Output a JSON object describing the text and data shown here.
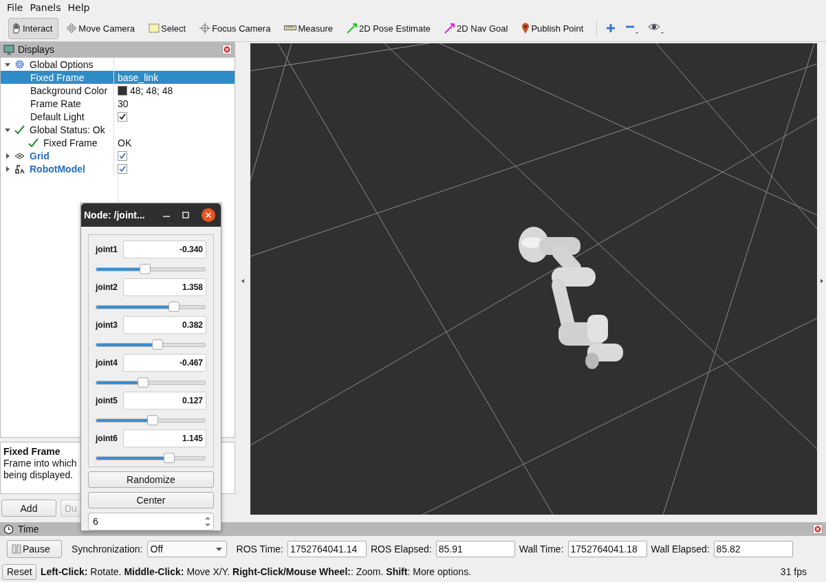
{
  "menu": [
    {
      "label": "File"
    },
    {
      "label": "Panels"
    },
    {
      "label": "Help"
    }
  ],
  "tools": [
    {
      "label": "Interact",
      "selected": true
    },
    {
      "label": "Move Camera",
      "selected": false
    },
    {
      "label": "Select",
      "selected": false
    },
    {
      "label": "Focus Camera",
      "selected": false
    },
    {
      "label": "Measure",
      "selected": false
    },
    {
      "label": "2D Pose Estimate",
      "selected": false
    },
    {
      "label": "2D Nav Goal",
      "selected": false
    },
    {
      "label": "Publish Point",
      "selected": false
    }
  ],
  "displays": {
    "title": "Displays",
    "items": [
      {
        "kind": "group",
        "label": "Global Options",
        "expanded": true,
        "selected": false,
        "children": [
          {
            "kind": "property",
            "label": "Fixed Frame",
            "value": "base_link",
            "selected": true
          },
          {
            "kind": "color",
            "label": "Background Color",
            "value": "48; 48; 48",
            "color": "#303030",
            "selected": false
          },
          {
            "kind": "property",
            "label": "Frame Rate",
            "value": "30",
            "selected": false
          },
          {
            "kind": "check",
            "label": "Default Light",
            "checked": true,
            "selected": false
          }
        ]
      },
      {
        "kind": "status",
        "label": "Global Status: Ok",
        "expanded": true,
        "selected": false,
        "children": [
          {
            "kind": "status",
            "label": "Fixed Frame",
            "value": "OK",
            "selected": false
          }
        ]
      },
      {
        "kind": "grid",
        "label": "Grid",
        "expanded": false,
        "checked": true,
        "selected": false
      },
      {
        "kind": "robot",
        "label": "RobotModel",
        "expanded": false,
        "checked": true,
        "selected": false
      }
    ],
    "description": {
      "title": "Fixed Frame",
      "lines": [
        "Frame into which",
        "being displayed."
      ]
    },
    "buttons": [
      {
        "label": "Add",
        "disabled": false
      },
      {
        "label": "Du",
        "disabled": true
      }
    ]
  },
  "node_window": {
    "title": "Node: /joint...",
    "joints": [
      {
        "name": "joint1",
        "value": "-0.340",
        "level": 0.45
      },
      {
        "name": "joint2",
        "value": "1.358",
        "level": 0.71
      },
      {
        "name": "joint3",
        "value": "0.382",
        "level": 0.56
      },
      {
        "name": "joint4",
        "value": "-0.467",
        "level": 0.43
      },
      {
        "name": "joint5",
        "value": "0.127",
        "level": 0.52
      },
      {
        "name": "joint6",
        "value": "1.145",
        "level": 0.67
      }
    ],
    "buttons": [
      "Randomize",
      "Center"
    ],
    "spin_value": "6"
  },
  "time_panel": {
    "title": "Time",
    "pause": "Pause",
    "sync_label": "Synchronization:",
    "sync_value": "Off",
    "fields": [
      {
        "label": "ROS Time:",
        "value": "1752764041.14"
      },
      {
        "label": "ROS Elapsed:",
        "value": "85.91"
      },
      {
        "label": "Wall Time:",
        "value": "1752764041.18"
      },
      {
        "label": "Wall Elapsed:",
        "value": "85.82"
      }
    ]
  },
  "status_bar": {
    "reset": "Reset",
    "hint": "**Left-Click:** Rotate. **Middle-Click:** Move X/Y. **Right-Click/Mouse Wheel:**: Zoom. **Shift**: More options.",
    "fps": "31 fps"
  }
}
